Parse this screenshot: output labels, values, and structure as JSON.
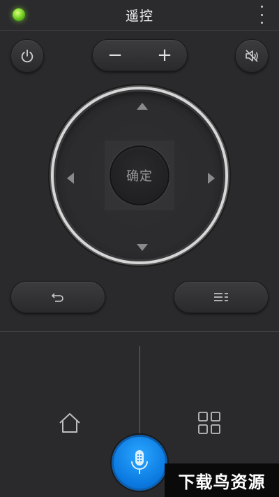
{
  "header": {
    "title": "遥控",
    "status_color": "#7ed321"
  },
  "controls": {
    "power_icon": "power-icon",
    "volume_down_label": "−",
    "volume_up_label": "+",
    "mute_icon": "speaker-muted-icon"
  },
  "dpad": {
    "ok_label": "确定",
    "ring_color": "#d6d6d6"
  },
  "nav": {
    "back_icon": "back-arrow-icon",
    "menu_icon": "menu-lines-icon",
    "home_icon": "home-icon",
    "apps_icon": "apps-grid-icon"
  },
  "voice": {
    "icon": "microphone-icon",
    "color": "#0a78e0"
  },
  "watermark": {
    "text": "下载鸟资源"
  }
}
